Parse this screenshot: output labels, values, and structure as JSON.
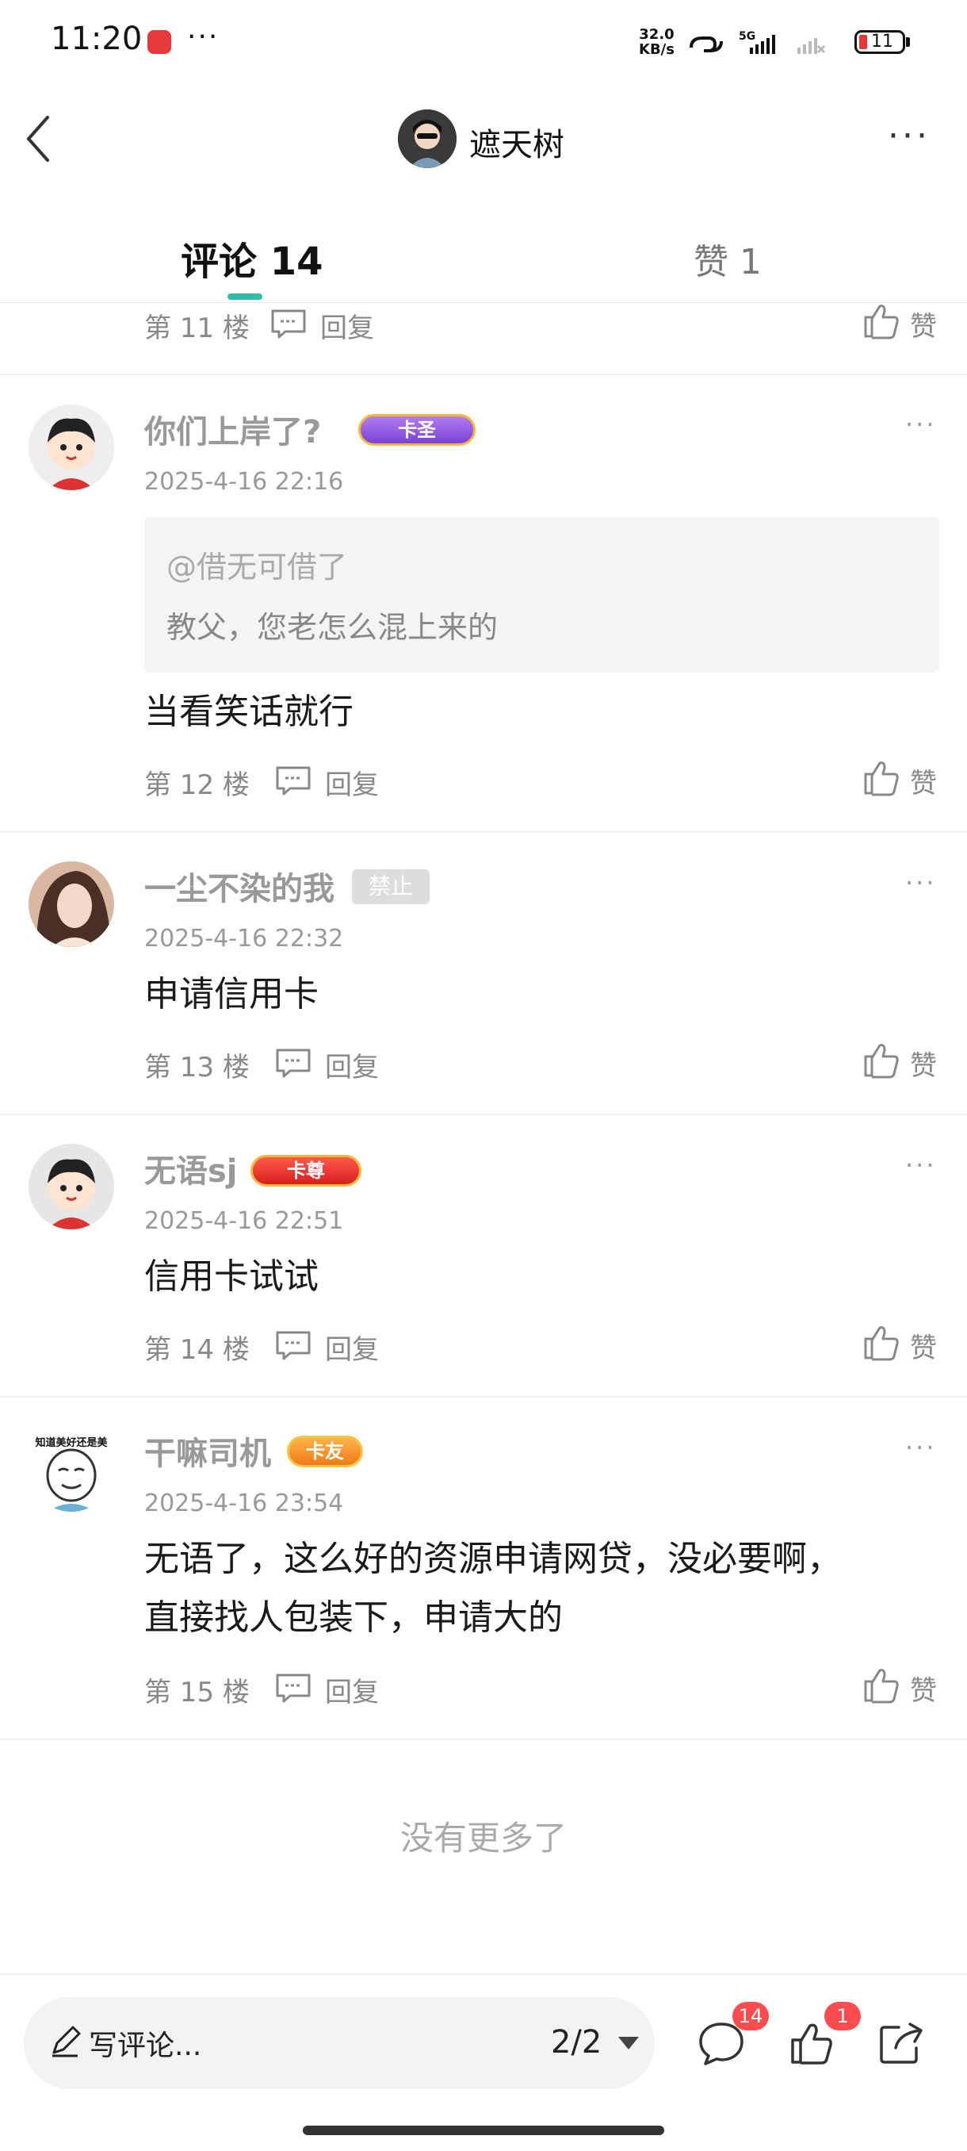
{
  "status_bar": {
    "time": "11:20",
    "more": "···",
    "net_speed_value": "32.0",
    "net_speed_unit": "KB/s",
    "network": "5G",
    "battery": "11"
  },
  "header": {
    "title": "遮天树",
    "more": "···"
  },
  "tabs": [
    {
      "label": "评论 14",
      "active": true
    },
    {
      "label": "赞 1",
      "active": false
    }
  ],
  "reply_label": "回复",
  "like_label": "赞",
  "comments": [
    {
      "floor": "第 11 楼"
    },
    {
      "floor": "第 12 楼",
      "user": "你们上岸了?",
      "badge": "卡圣",
      "date": "2025-4-16 22:16",
      "quote_user": "@借无可借了",
      "quote_text": "教父，您老怎么混上来的",
      "text": "当看笑话就行"
    },
    {
      "floor": "第 13 楼",
      "user": "一尘不染的我",
      "tag": "禁止",
      "date": "2025-4-16 22:32",
      "text": "申请信用卡"
    },
    {
      "floor": "第 14 楼",
      "user": "无语sj",
      "badge": "卡尊",
      "date": "2025-4-16 22:51",
      "text": "信用卡试试"
    },
    {
      "floor": "第 15 楼",
      "user": "干嘛司机",
      "badge": "卡友",
      "date": "2025-4-16 23:54",
      "avatar_caption": "知道美好还是美",
      "text_lines": [
        "无语了，这么好的资源申请网贷，没必要啊，",
        "直接找人包装下，申请大的"
      ]
    }
  ],
  "no_more": "没有更多了",
  "bottom": {
    "placeholder": "写评论...",
    "page": "2/2",
    "comment_count": "14",
    "like_count": "1"
  },
  "colors": {
    "accent": "#2dbfa6",
    "badge_red": "#ff4d4f"
  }
}
